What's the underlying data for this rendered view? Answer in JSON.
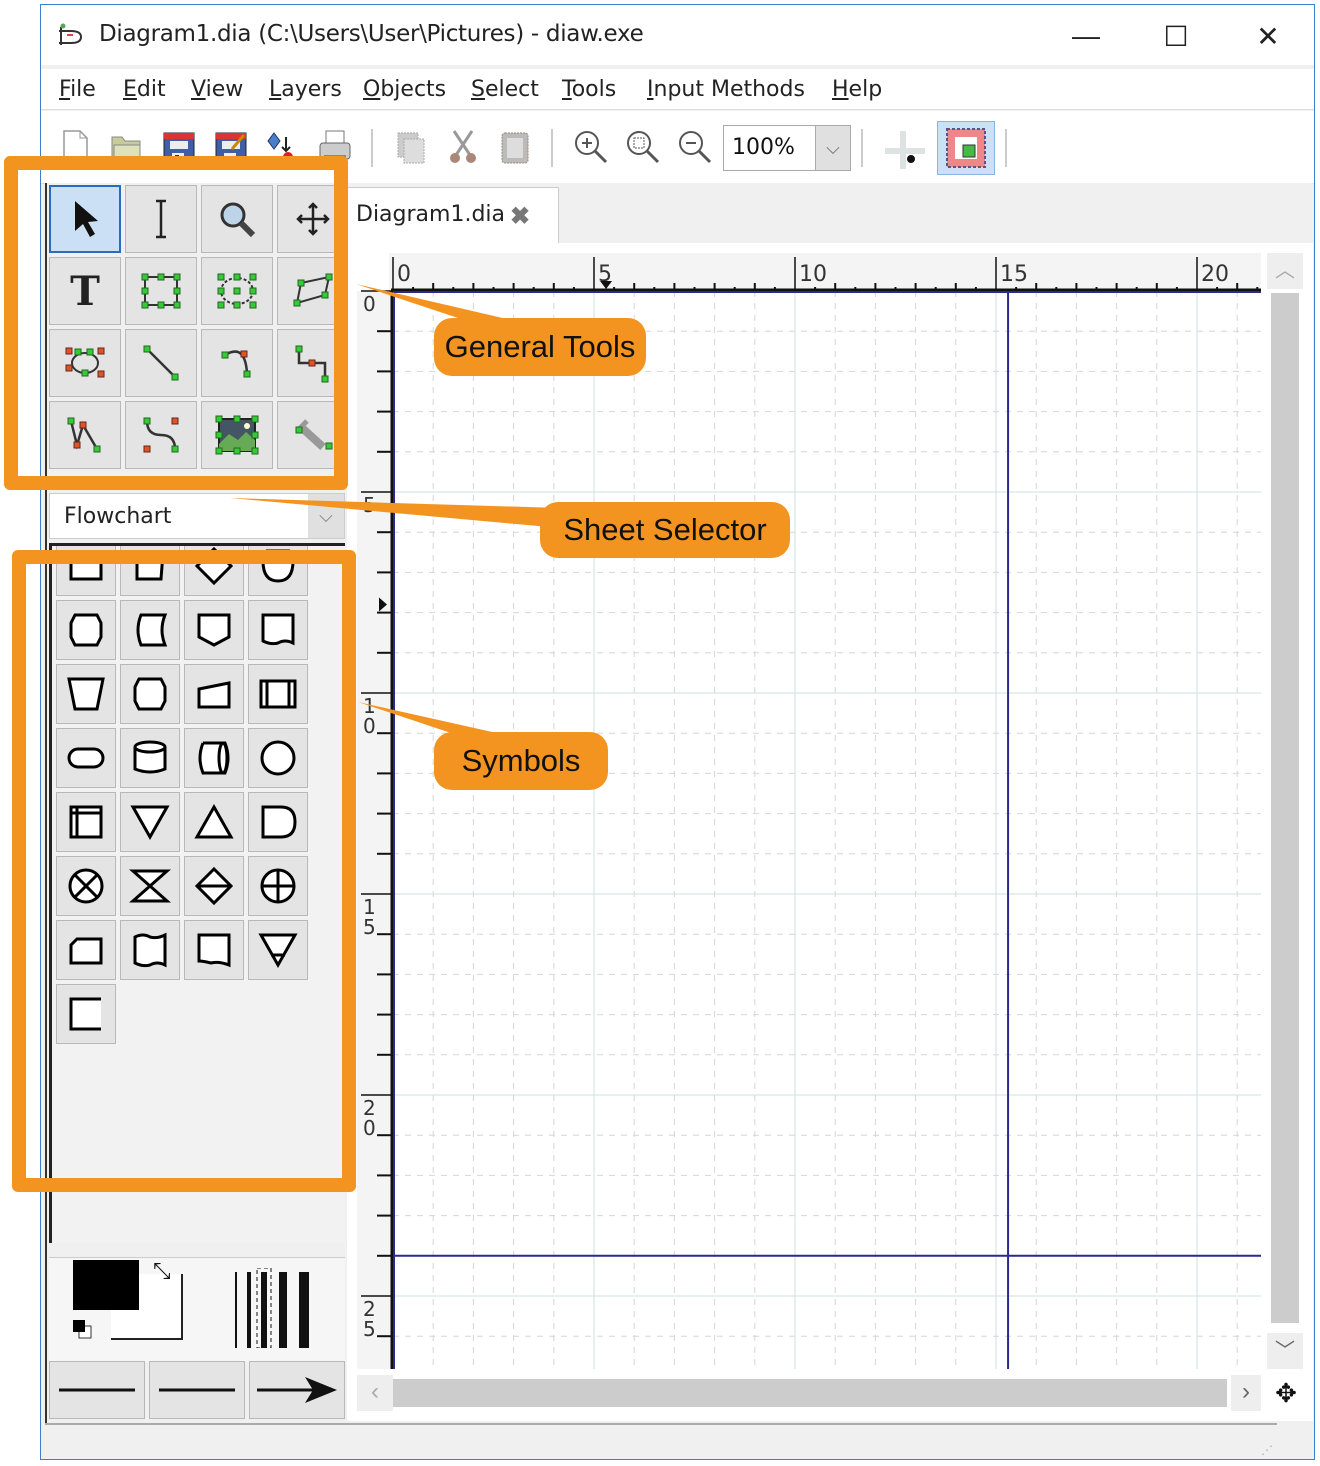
{
  "window": {
    "title": "Diagram1.dia (C:\\Users\\User\\Pictures) - diaw.exe",
    "app_icon": "dia-app-icon",
    "controls": {
      "minimize": "—",
      "maximize": "☐",
      "close": "✕"
    }
  },
  "menubar": {
    "items": [
      {
        "label": "File",
        "accel": "F"
      },
      {
        "label": "Edit",
        "accel": "E"
      },
      {
        "label": "View",
        "accel": "V"
      },
      {
        "label": "Layers",
        "accel": "L"
      },
      {
        "label": "Objects",
        "accel": "O"
      },
      {
        "label": "Select",
        "accel": "S"
      },
      {
        "label": "Tools",
        "accel": "T"
      },
      {
        "label": "Input Methods",
        "accel": "I"
      },
      {
        "label": "Help",
        "accel": "H"
      }
    ]
  },
  "toolbar": {
    "buttons": [
      "new-icon",
      "open-icon",
      "save-icon",
      "save-as-icon",
      "export-icon",
      "print-icon",
      "copy-icon",
      "cut-icon",
      "paste-icon",
      "zoom-in-icon",
      "zoom-fit-icon",
      "zoom-out-icon"
    ],
    "zoom_value": "100%",
    "snap_to_grid": "snap-grid-icon",
    "snap_to_objects": "snap-objects-icon"
  },
  "tools": {
    "items": [
      {
        "name": "modify",
        "icon": "pointer-icon",
        "active": true
      },
      {
        "name": "text-edit",
        "icon": "text-cursor-icon"
      },
      {
        "name": "magnify",
        "icon": "magnifier-icon"
      },
      {
        "name": "scroll",
        "icon": "move-icon"
      },
      {
        "name": "text",
        "icon": "text-T-icon"
      },
      {
        "name": "box",
        "icon": "box-icon"
      },
      {
        "name": "ellipse",
        "icon": "ellipse-icon"
      },
      {
        "name": "polygon",
        "icon": "polygon-icon"
      },
      {
        "name": "beziergon",
        "icon": "beziergon-icon"
      },
      {
        "name": "line",
        "icon": "line-icon"
      },
      {
        "name": "arc",
        "icon": "arc-icon"
      },
      {
        "name": "zigzag-line",
        "icon": "zigzag-line-icon"
      },
      {
        "name": "polyline",
        "icon": "polyline-icon"
      },
      {
        "name": "bezier-line",
        "icon": "bezier-line-icon"
      },
      {
        "name": "image",
        "icon": "image-icon"
      },
      {
        "name": "outline",
        "icon": "outline-icon"
      }
    ]
  },
  "sheet_selector": {
    "value": "Flowchart"
  },
  "symbols": {
    "count": 29,
    "items": [
      "process",
      "manual-input",
      "decision",
      "display",
      "preparation",
      "stored-data",
      "offpage-connector",
      "punched-card",
      "manual-operation",
      "prep-alt",
      "card",
      "predefined-process",
      "terminal",
      "disk-storage",
      "direct-access",
      "connector",
      "internal-storage",
      "merge",
      "extract",
      "delay",
      "or",
      "collate",
      "sort",
      "summing-junction",
      "manual-loop",
      "punched-tape",
      "document",
      "offline-storage",
      "annotation"
    ]
  },
  "attributes": {
    "foreground_color": "#000000",
    "background_color": "#ffffff",
    "line_widths": 5,
    "line_start": "plain",
    "line_style": "solid",
    "line_end": "arrow"
  },
  "document_tab": {
    "label": "Diagram1.dia",
    "close": "✖"
  },
  "rulers": {
    "horizontal_labels": [
      "0",
      "5",
      "10",
      "15",
      "20"
    ],
    "vertical_labels": [
      "0",
      "5",
      "10",
      "15",
      "20",
      "25"
    ]
  },
  "annotations": {
    "general_tools": "General Tools",
    "sheet_selector": "Sheet Selector",
    "symbols": "Symbols",
    "color": "#f39420"
  },
  "colors": {
    "page_border": "#2a2a8a",
    "grid_major": "#cfe0e0",
    "grid_minor": "#d8d8d8",
    "accent": "#3a7fd0"
  }
}
